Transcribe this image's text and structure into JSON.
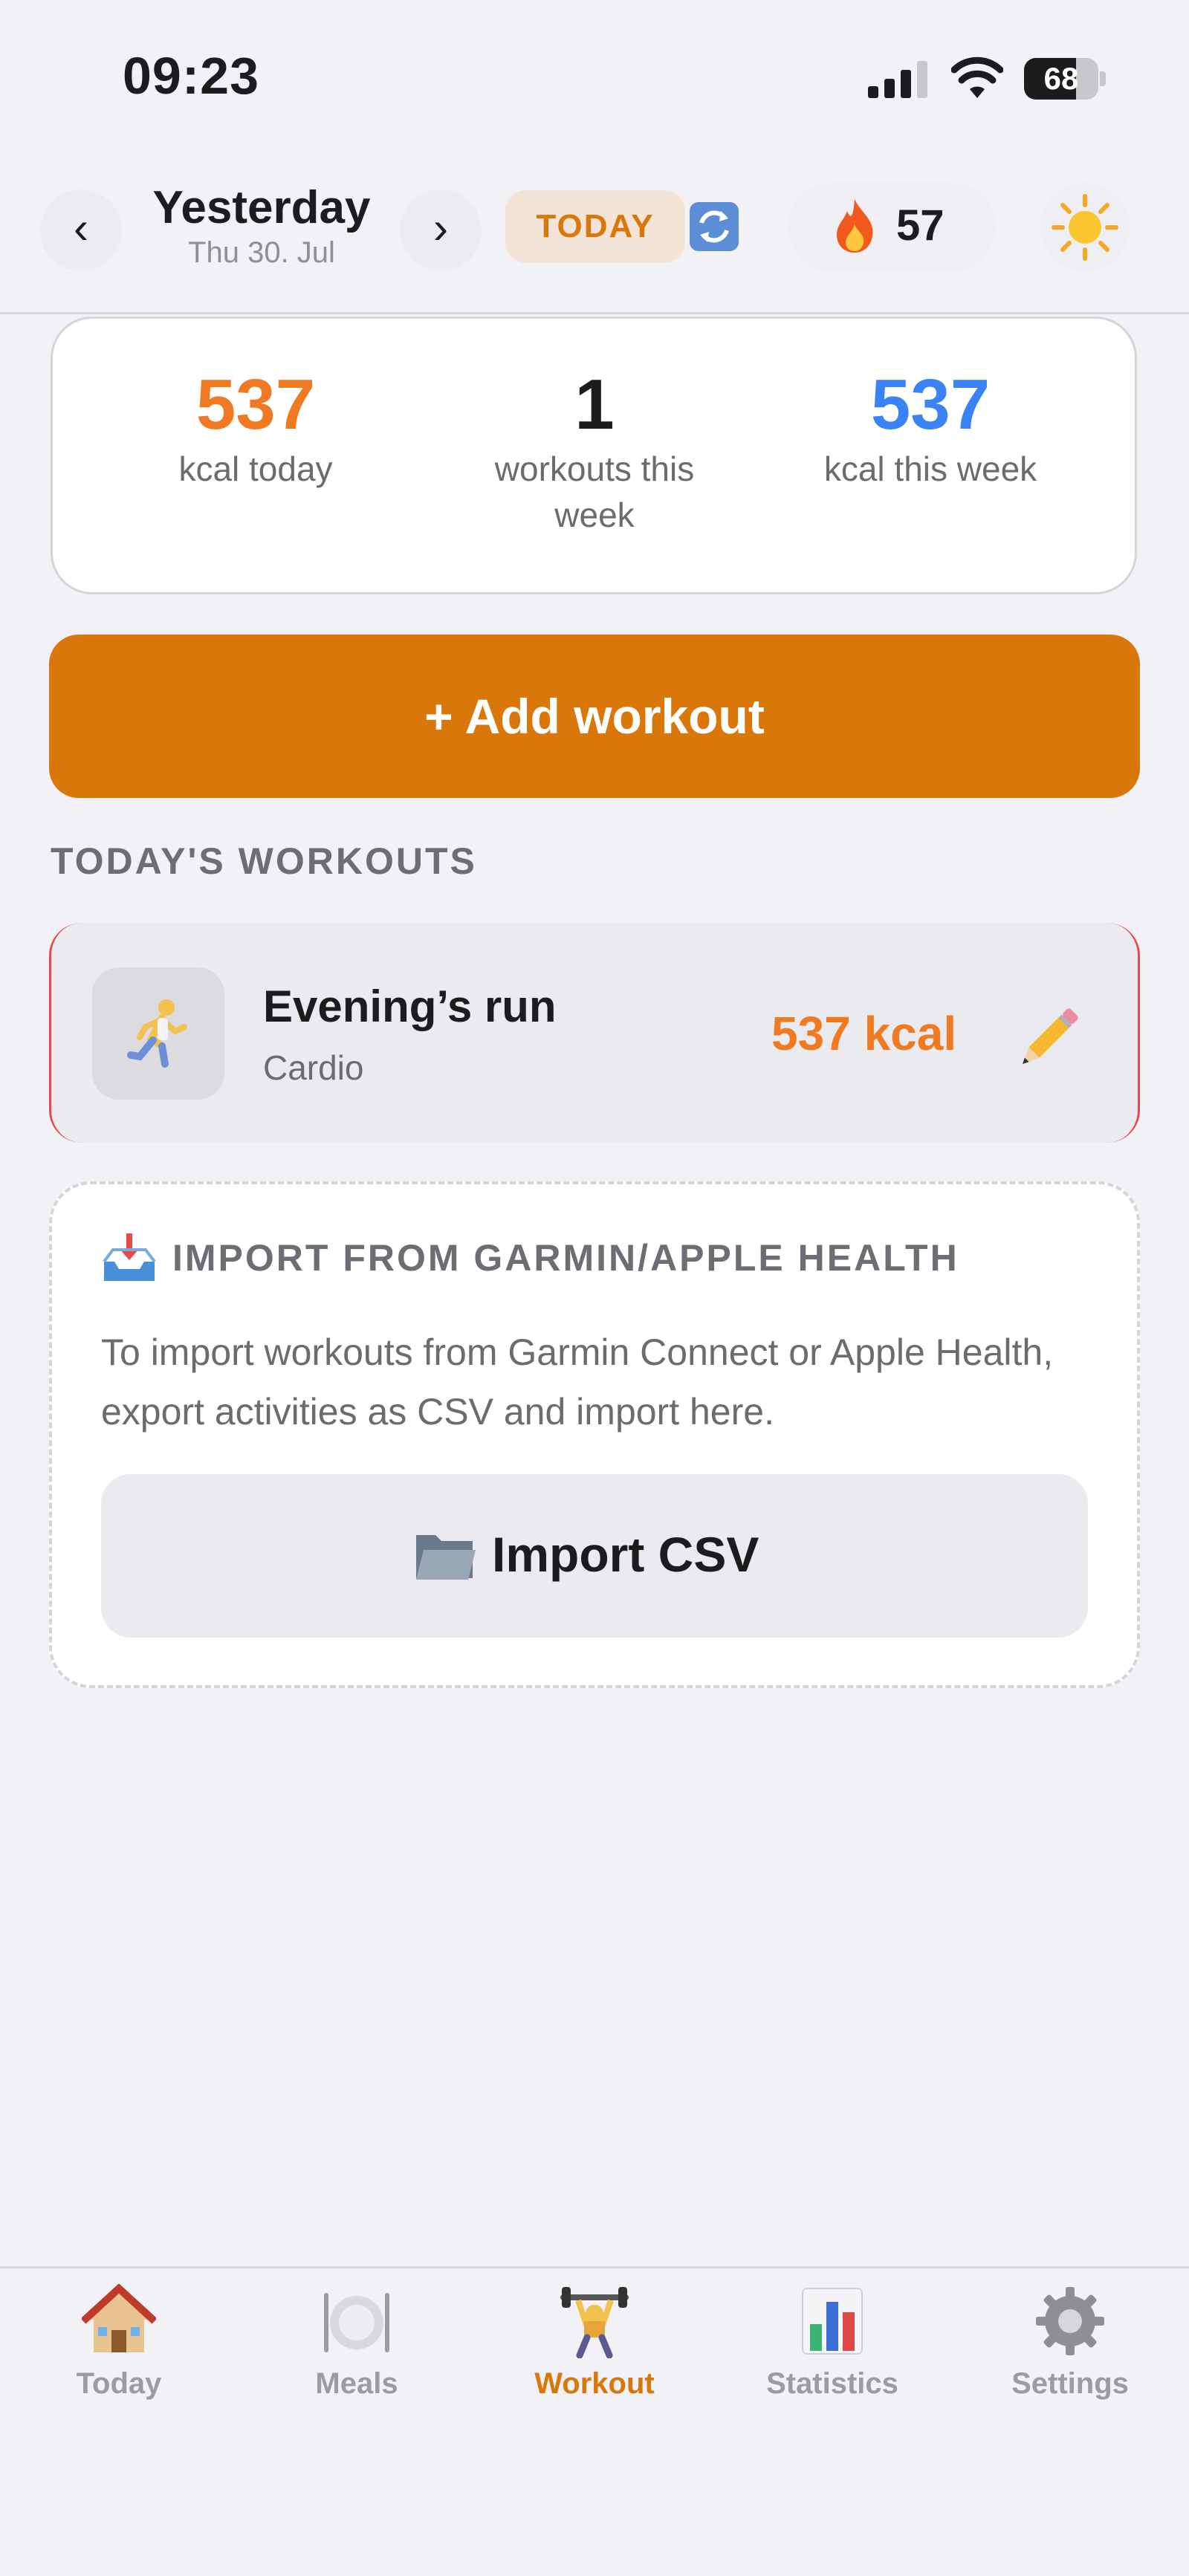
{
  "status_bar": {
    "time": "09:23",
    "battery": "68"
  },
  "header": {
    "prev_label": "‹",
    "next_label": "›",
    "date_title": "Yesterday",
    "date_sub": "Thu 30. Jul",
    "today_button": "TODAY",
    "streak_count": "57",
    "icons": {
      "sync": "sync-icon",
      "streak": "flame-icon",
      "theme": "sun-icon"
    }
  },
  "summary": [
    {
      "value": "537",
      "label": "kcal today",
      "color": "#f07a22"
    },
    {
      "value": "1",
      "label": "workouts this week",
      "color": "#1c1c1e"
    },
    {
      "value": "537",
      "label": "kcal this week",
      "color": "#3b82f6"
    }
  ],
  "add_workout_label": "+ Add workout",
  "section_title": "TODAY'S WORKOUTS",
  "workouts": [
    {
      "name": "Evening’s run",
      "category": "Cardio",
      "kcal": "537 kcal",
      "icon": "runner-icon"
    }
  ],
  "import": {
    "title": "IMPORT FROM GARMIN/APPLE HEALTH",
    "description": "To import workouts from Garmin Connect or Apple Health, export activities as CSV and import here.",
    "button_label": "Import CSV"
  },
  "tabs": [
    {
      "label": "Today",
      "icon": "house-icon",
      "active": false
    },
    {
      "label": "Meals",
      "icon": "plate-icon",
      "active": false
    },
    {
      "label": "Workout",
      "icon": "weightlifter-icon",
      "active": true
    },
    {
      "label": "Statistics",
      "icon": "bar-chart-icon",
      "active": false
    },
    {
      "label": "Settings",
      "icon": "gear-icon",
      "active": false
    }
  ],
  "colors": {
    "accent": "#d9770a",
    "kcal_orange": "#f07a22",
    "week_blue": "#3b82f6",
    "background": "#f2f1f6"
  }
}
